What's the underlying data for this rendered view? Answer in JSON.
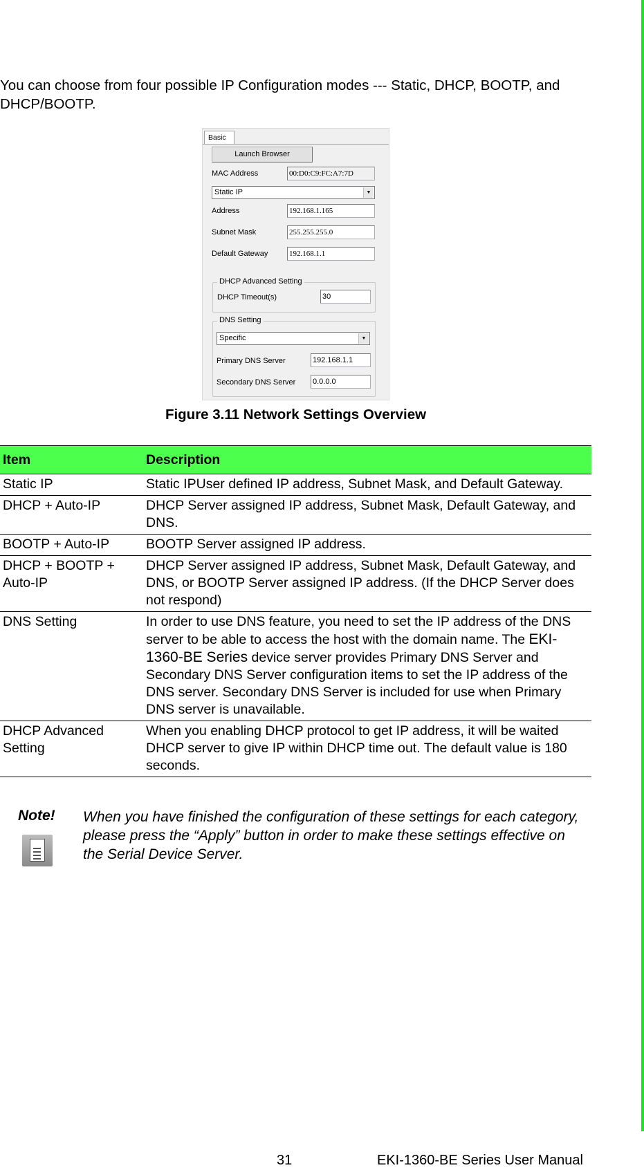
{
  "intro": "You can choose from four possible IP Configuration modes --- Static, DHCP, BOOTP, and DHCP/BOOTP.",
  "figure": {
    "tab": "Basic",
    "launch_button": "Launch Browser",
    "mac_label": "MAC Address",
    "mac_value": "00:D0:C9:FC:A7:7D",
    "mode_select": "Static IP",
    "address_label": "Address",
    "address_value": "192.168.1.165",
    "subnet_label": "Subnet Mask",
    "subnet_value": "255.255.255.0",
    "gateway_label": "Default Gateway",
    "gateway_value": "192.168.1.1",
    "dhcp_group": "DHCP Advanced Setting",
    "dhcp_timeout_label": "DHCP Timeout(s)",
    "dhcp_timeout_value": "30",
    "dns_group": "DNS Setting",
    "dns_select": "Specific",
    "primary_dns_label": "Primary DNS Server",
    "primary_dns_value": "192.168.1.1",
    "secondary_dns_label": "Secondary DNS Server",
    "secondary_dns_value": "0.0.0.0",
    "dropdown_icon": "chevron-down-icon"
  },
  "caption": "Figure 3.11 Network Settings Overview",
  "table": {
    "headers": [
      "Item",
      "Description"
    ],
    "rows": [
      {
        "item": "Static IP",
        "desc": "Static IPUser defined IP address, Subnet Mask, and Default Gateway."
      },
      {
        "item": "DHCP + Auto-IP",
        "desc": "DHCP Server assigned IP address, Subnet Mask, Default Gateway, and DNS."
      },
      {
        "item": "BOOTP + Auto-IP",
        "desc": "BOOTP Server assigned IP address."
      },
      {
        "item": "DHCP + BOOTP + Auto-IP",
        "desc": "DHCP Server assigned IP address, Subnet Mask, Default Gateway, and DNS, or BOOTP Server assigned IP address. (If the DHCP Server does not respond)"
      },
      {
        "item": "DNS Setting",
        "desc_pre": "In order to use DNS feature, you need to set the IP address of the DNS server to be able to access the host with the domain name. The ",
        "desc_product": "EKI-1360-BE Series",
        "desc_post": " device server provides Primary DNS Server and Secondary DNS Server configuration items to set the IP address of the DNS server. Secondary DNS Server is included for use when Primary DNS server is unavailable."
      },
      {
        "item": "DHCP Advanced Setting",
        "desc": "When you enabling DHCP protocol to get IP address, it will be waited DHCP server to give IP within DHCP time out. The default value is 180 seconds."
      }
    ]
  },
  "note": {
    "title": "Note!",
    "icon": "document-icon",
    "text": "When you have finished the configuration of these settings for each category, please press the “Apply” button in order to make these settings effective on the Serial Device Server."
  },
  "footer": {
    "page_number": "31",
    "manual_title": "EKI-1360-BE Series User Manual"
  },
  "colors": {
    "accent_green": "#4dff4d",
    "side_bar_green": "#22e02a"
  }
}
